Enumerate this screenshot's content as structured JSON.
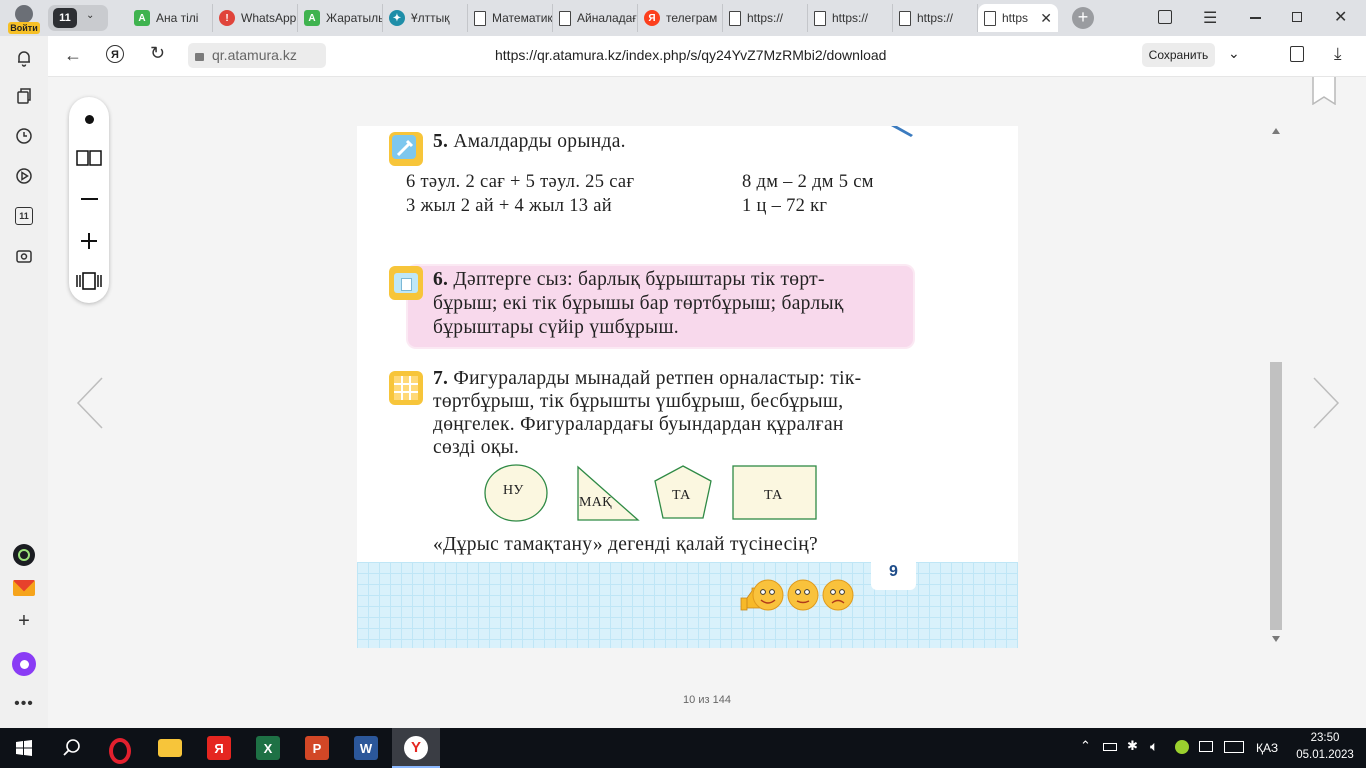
{
  "browser": {
    "login_label": "Войти",
    "tab_count": "11",
    "tabs": [
      {
        "title": "Ана тілі",
        "color": "#3fb34f",
        "glyph": "A"
      },
      {
        "title": "WhatsApp",
        "color": "#e0443b",
        "glyph": "!"
      },
      {
        "title": "Жаратылыстану",
        "color": "#3fb34f",
        "glyph": "A"
      },
      {
        "title": "Ұлттық",
        "color": "#1f8ea8",
        "glyph": "✦"
      },
      {
        "title": "Математика",
        "color": "doc",
        "glyph": ""
      },
      {
        "title": "Айналадағы",
        "color": "doc",
        "glyph": ""
      },
      {
        "title": "телеграм",
        "color": "#fc3f1d",
        "glyph": "Я"
      },
      {
        "title": "https://",
        "color": "doc",
        "glyph": ""
      },
      {
        "title": "https://",
        "color": "doc",
        "glyph": ""
      },
      {
        "title": "https://",
        "color": "doc",
        "glyph": ""
      },
      {
        "title": "https",
        "color": "doc",
        "glyph": ""
      }
    ],
    "site_label": "qr.atamura.kz",
    "url": "https://qr.atamura.kz/index.php/s/qy24YvZ7MzRMbi2/download",
    "save_label": "Сохранить"
  },
  "viewer": {
    "page_counter": "10 из 144"
  },
  "book_page": {
    "task5": {
      "number": "5.",
      "title": "Амалдарды орында.",
      "expr_left_1": "6 тәул. 2 сағ + 5 тәул. 25 сағ",
      "expr_left_2": "3 жыл 2 ай + 4 жыл 13 ай",
      "expr_right_1": "8 дм – 2 дм 5 см",
      "expr_right_2": "1 ц – 72 кг"
    },
    "task6": {
      "number": "6.",
      "line1": "Дәптерге сыз: барлық бұрыштары тік төрт-",
      "line2": "бұрыш; екі тік бұрышы бар төртбұрыш; барлық",
      "line3": "бұрыштары сүйір үшбұрыш."
    },
    "task7": {
      "number": "7.",
      "line1": "Фигураларды мынадай ретпен орналастыр: тік-",
      "line2": "төртбұрыш, тік бұрышты үшбұрыш, бесбұрыш,",
      "line3": "дөңгелек. Фигуралардағы буындардан құралған",
      "line4": "сөзді оқы."
    },
    "shapes": {
      "circle": "НУ",
      "triangle": "МАҚ",
      "pentagon": "ТА",
      "rectangle": "ТА"
    },
    "question": "«Дұрыс тамақтану» дегенді қалай түсінесің?",
    "page_number": "9"
  },
  "taskbar": {
    "language": "ҚАЗ",
    "time": "23:50",
    "date": "05.01.2023"
  },
  "colors": {
    "pink_box": "#f8d9ec",
    "shape_fill": "#fbf7e0",
    "shape_stroke": "#2f8a45",
    "grid_band": "#d9f1fb"
  }
}
